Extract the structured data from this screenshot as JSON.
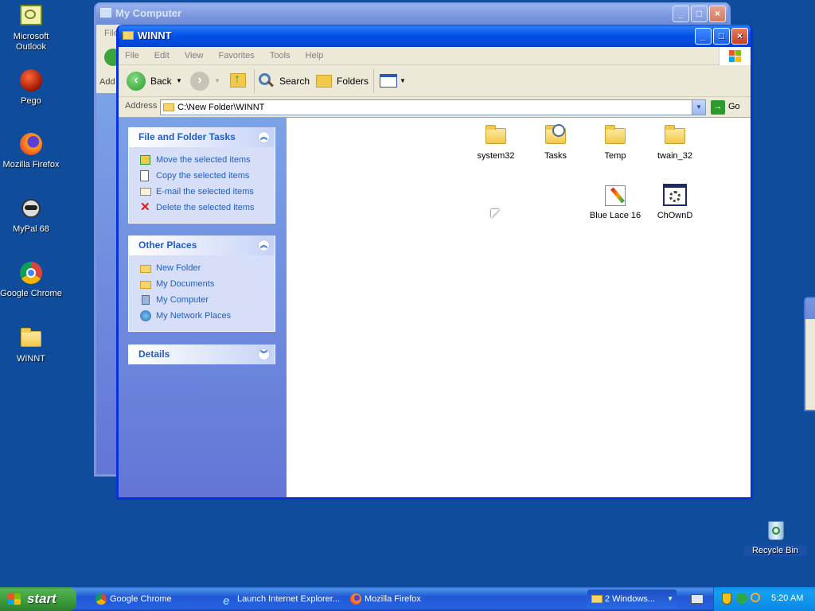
{
  "desktop": {
    "icons": [
      {
        "label_1": "Microsoft",
        "label_2": "Outlook"
      },
      {
        "label": "Pego"
      },
      {
        "label": "Mozilla Firefox"
      },
      {
        "label": "MyPal 68"
      },
      {
        "label": "Google Chrome"
      },
      {
        "label": "WINNT"
      },
      {
        "label": "Recycle Bin"
      }
    ]
  },
  "back_window": {
    "title": "My Computer",
    "menu_peek": "File",
    "address_peek": "Add"
  },
  "window": {
    "title": "WINNT",
    "menu": [
      "File",
      "Edit",
      "View",
      "Favorites",
      "Tools",
      "Help"
    ],
    "toolbar": {
      "back": "Back",
      "search": "Search",
      "folders": "Folders"
    },
    "address": {
      "label": "Address",
      "value": "C:\\New Folder\\WINNT",
      "go": "Go"
    },
    "tasks_panel": {
      "title": "File and Folder Tasks",
      "items": [
        "Move the selected items",
        "Copy the selected items",
        "E-mail the selected items",
        "Delete the selected items"
      ]
    },
    "places_panel": {
      "title": "Other Places",
      "items": [
        "New Folder",
        "My Documents",
        "My Computer",
        "My Network Places"
      ]
    },
    "details_panel": {
      "title": "Details"
    },
    "files": [
      "system32",
      "Tasks",
      "Temp",
      "twain_32",
      "Blue Lace 16",
      "ChOwnD"
    ]
  },
  "taskbar": {
    "start": "start",
    "tasks": [
      "Google Chrome",
      "Launch Internet Explorer...",
      "Mozilla Firefox",
      "2 Windows..."
    ],
    "clock": "5:20 AM"
  },
  "colors": {
    "desktop": "#0f4c9c",
    "titlebar": "#0050e6",
    "sidebar_link": "#215dc6",
    "start_green": "#3a9b3a"
  }
}
